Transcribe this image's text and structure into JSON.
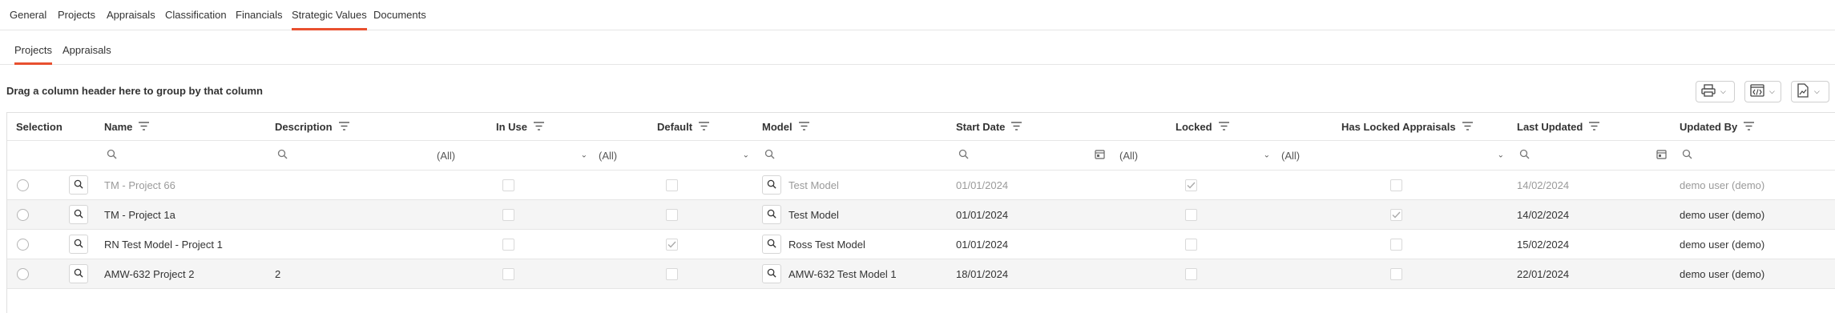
{
  "tabs": [
    {
      "label": "General"
    },
    {
      "label": "Projects"
    },
    {
      "label": "Appraisals"
    },
    {
      "label": "Classification"
    },
    {
      "label": "Financials"
    },
    {
      "label": "Strategic Values",
      "active": true
    },
    {
      "label": "Documents"
    }
  ],
  "subtabs": [
    {
      "label": "Projects",
      "active": true
    },
    {
      "label": "Appraisals"
    }
  ],
  "grid": {
    "group_hint": "Drag a column header here to group by that column",
    "toolbar": [
      "print-icon",
      "export-html-icon",
      "export-image-icon"
    ],
    "columns": {
      "selection": "Selection",
      "name": "Name",
      "description": "Description",
      "in_use": "In Use",
      "default": "Default",
      "model": "Model",
      "start_date": "Start Date",
      "locked": "Locked",
      "has_locked_appraisals": "Has Locked Appraisals",
      "last_updated": "Last Updated",
      "updated_by": "Updated By"
    },
    "filters": {
      "in_use": "(All)",
      "default": "(All)",
      "locked": "(All)",
      "has_locked_appraisals": "(All)"
    },
    "rows": [
      {
        "name": "TM - Project 66",
        "description": "",
        "in_use": false,
        "default": false,
        "model": "Test Model",
        "start_date": "01/01/2024",
        "locked": true,
        "has_locked_appraisals": false,
        "last_updated": "14/02/2024",
        "updated_by": "demo user (demo)",
        "dimmed": true
      },
      {
        "name": "TM - Project 1a",
        "description": "",
        "in_use": false,
        "default": false,
        "model": "Test Model",
        "start_date": "01/01/2024",
        "locked": false,
        "has_locked_appraisals": true,
        "last_updated": "14/02/2024",
        "updated_by": "demo user (demo)",
        "dimmed": false
      },
      {
        "name": "RN Test Model - Project 1",
        "description": "",
        "in_use": false,
        "default": true,
        "model": "Ross Test Model",
        "start_date": "01/01/2024",
        "locked": false,
        "has_locked_appraisals": false,
        "last_updated": "15/02/2024",
        "updated_by": "demo user (demo)",
        "dimmed": false
      },
      {
        "name": "AMW-632 Project 2",
        "description": "2",
        "in_use": false,
        "default": false,
        "model": "AMW-632 Test Model 1",
        "start_date": "18/01/2024",
        "locked": false,
        "has_locked_appraisals": false,
        "last_updated": "22/01/2024",
        "updated_by": "demo user (demo)",
        "dimmed": false
      }
    ]
  },
  "colors": {
    "accent": "#e8502f",
    "alt_row": "#f5f5f5",
    "border": "#e0e0e0"
  }
}
